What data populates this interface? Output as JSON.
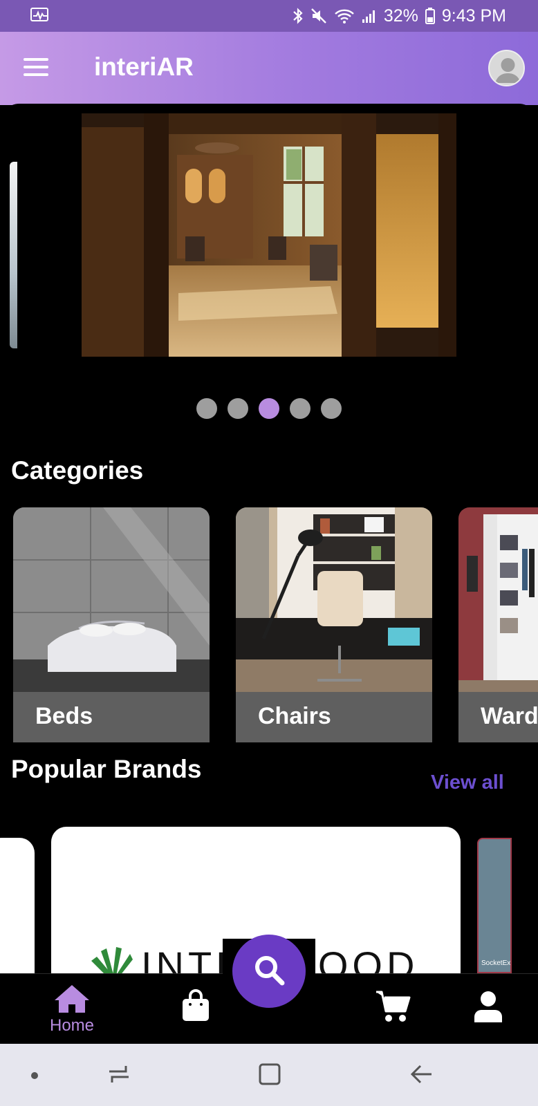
{
  "status_bar": {
    "battery_percent": "32%",
    "time": "9:43 PM",
    "icons": [
      "activity-icon",
      "bluetooth-icon",
      "mute-icon",
      "wifi-icon",
      "signal-icon",
      "battery-icon"
    ]
  },
  "app_bar": {
    "title": "interiAR",
    "menu_icon": "hamburger-menu-icon",
    "avatar_icon": "user-avatar-icon"
  },
  "carousel": {
    "slide_count": 5,
    "active_index": 2,
    "current_slide": "wood-paneled-interior-photo"
  },
  "categories": {
    "title": "Categories",
    "items": [
      {
        "label": "Beds"
      },
      {
        "label": "Chairs"
      },
      {
        "label": "Ward"
      }
    ]
  },
  "brands": {
    "title": "Popular Brands",
    "view_all": "View all",
    "items": [
      {
        "name": "INTERWOOD"
      },
      {
        "name": "SocketExc"
      }
    ]
  },
  "bottom_nav": {
    "items": [
      {
        "label": "Home",
        "icon": "home-icon",
        "active": true
      },
      {
        "label": "",
        "icon": "shopping-bag-icon",
        "active": false
      },
      {
        "label": "",
        "icon": "cart-icon",
        "active": false
      },
      {
        "label": "",
        "icon": "profile-icon",
        "active": false
      }
    ],
    "fab_icon": "search-icon"
  },
  "colors": {
    "accent": "#6a3bc4",
    "active": "#b88ce0",
    "view_all": "#6c4fd0",
    "status_bar": "#7a58b4"
  }
}
